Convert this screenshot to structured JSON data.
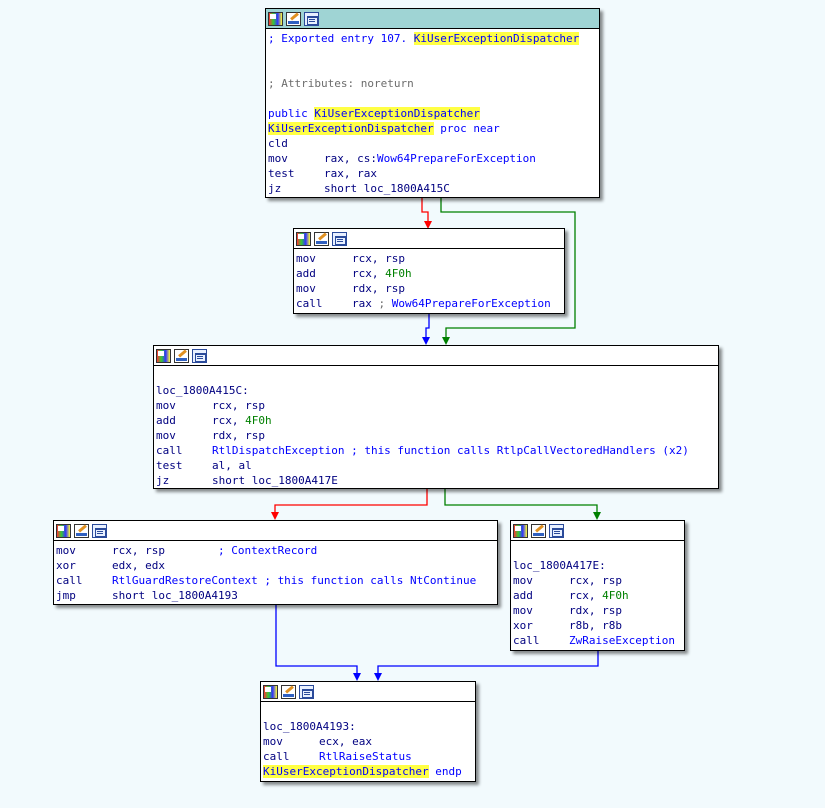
{
  "nodes": {
    "n0": {
      "comment1_prefix": "; Exported entry 107. ",
      "comment1_name": "KiUserExceptionDispatcher",
      "comment2": "; Attributes: noreturn",
      "public_kw": "public ",
      "func_name": "KiUserExceptionDispatcher",
      "proc_suffix": " proc near",
      "lines": [
        {
          "mn": "cld",
          "ops": ""
        },
        {
          "mn": "mov",
          "ops_a": "rax, cs:",
          "ops_ref": "Wow64PrepareForException"
        },
        {
          "mn": "test",
          "ops": "rax, rax"
        },
        {
          "mn": "jz",
          "ops": "short loc_1800A415C"
        }
      ]
    },
    "n1": {
      "l1_mn": "mov",
      "l1_ops": "rcx, rsp",
      "l2_mn": "add",
      "l2_ops_a": "rcx, ",
      "l2_num": "4F0h",
      "l3_mn": "mov",
      "l3_ops": "rdx, rsp",
      "l4_mn": "call",
      "l4_ops_a": "rax ",
      "l4_cmt": "; ",
      "l4_ref": "Wow64PrepareForException"
    },
    "n2": {
      "label": "loc_1800A415C:",
      "l1_mn": "mov",
      "l1_ops": "rcx, rsp",
      "l2_mn": "add",
      "l2_ops_a": "rcx, ",
      "l2_num": "4F0h",
      "l3_mn": "mov",
      "l3_ops": "rdx, rsp",
      "l4_mn": "call",
      "l4_ops": "RtlDispatchException ; this function calls RtlpCallVectoredHandlers (x2)",
      "l5_mn": "test",
      "l5_ops": "al, al",
      "l6_mn": "jz",
      "l6_ops": "short loc_1800A417E"
    },
    "n3": {
      "l1_mn": "mov",
      "l1_ops": "rcx, rsp",
      "l1_cmt": "        ; ContextRecord",
      "l2_mn": "xor",
      "l2_ops": "edx, edx",
      "l3_mn": "call",
      "l3_ops": "RtlGuardRestoreContext ; this function calls NtContinue",
      "l4_mn": "jmp",
      "l4_ops": "short loc_1800A4193"
    },
    "n4": {
      "label": "loc_1800A417E:",
      "l1_mn": "mov",
      "l1_ops": "rcx, rsp",
      "l2_mn": "add",
      "l2_ops_a": "rcx, ",
      "l2_num": "4F0h",
      "l3_mn": "mov",
      "l3_ops": "rdx, rsp",
      "l4_mn": "xor",
      "l4_ops": "r8b, r8b",
      "l5_mn": "call",
      "l5_ops": "ZwRaiseException"
    },
    "n5": {
      "label": "loc_1800A4193:",
      "l1_mn": "mov",
      "l1_ops": "ecx, eax",
      "l2_mn": "call",
      "l2_ops": "RtlRaiseStatus",
      "endp_name": "KiUserExceptionDispatcher",
      "endp_kw": " endp"
    }
  },
  "icons": [
    "color-palette-icon",
    "edit-node-icon",
    "graph-overview-icon"
  ],
  "colors": {
    "background": "#f2fafd",
    "selected_title": "#9fd4d4",
    "edge_true": "#008000",
    "edge_false": "#ff0000",
    "edge_jump": "#0000ff",
    "highlight": "#ffff44"
  }
}
